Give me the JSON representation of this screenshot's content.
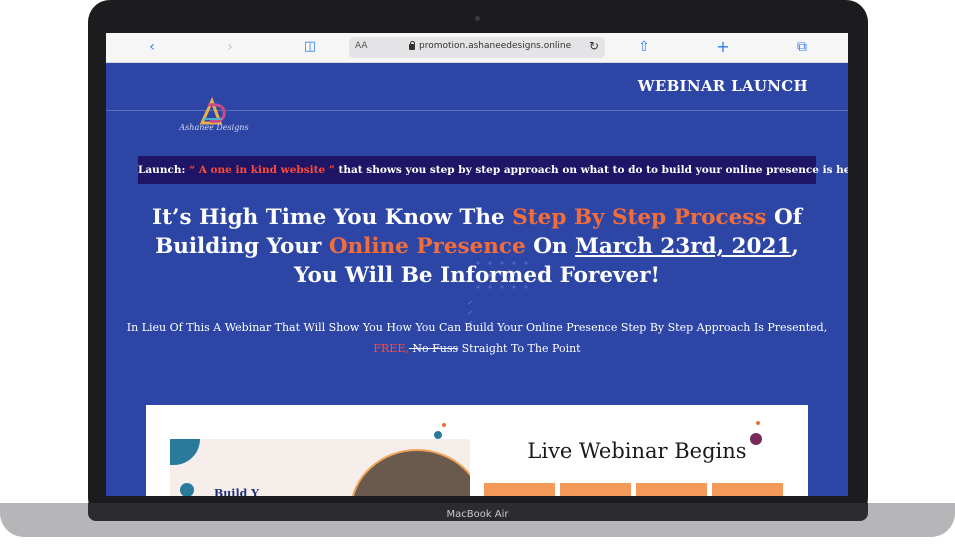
{
  "device": {
    "label": "MacBook Air"
  },
  "browser": {
    "url": "promotion.ashaneedesigns.online",
    "text_size_label": "AA",
    "icons": [
      "chevron-left-icon",
      "chevron-right-icon",
      "book-icon",
      "lock-icon",
      "reload-icon",
      "share-icon",
      "plus-icon",
      "tabs-icon"
    ]
  },
  "header": {
    "logo_text": "Ashanee Designs",
    "nav_title": "WEBINAR LAUNCH"
  },
  "launch": {
    "prefix": "Launch: ",
    "highlight": "“ A one in kind website ”",
    "rest": " that shows you step by step approach on what to do to build your online presence is here"
  },
  "headline": {
    "part1": "It’s High Time You Know The ",
    "highlight1": "Step By Step Process",
    "part2": " Of Building Your ",
    "highlight2": "Online Presence",
    "part3": " On ",
    "date": "March 23rd, 2021",
    "part4": ", You Will Be Informed Forever!"
  },
  "subline": {
    "text": "In Lieu Of This A Webinar That Will Show You How You Can Build Your Online Presence Step By Step Approach Is Presented,",
    "free": "FREE,",
    "no_fuss": " No Fuss",
    "end": " Straight To The Point"
  },
  "card": {
    "partial_text": "Build Y",
    "webinar_title": "Live Webinar Begins"
  },
  "colors": {
    "page_bg": "#2d46a6",
    "launch_bg": "#1e1566",
    "accent_orange": "#f36d3a",
    "accent_red": "#ff4b3a",
    "tile": "#f39a5a"
  }
}
